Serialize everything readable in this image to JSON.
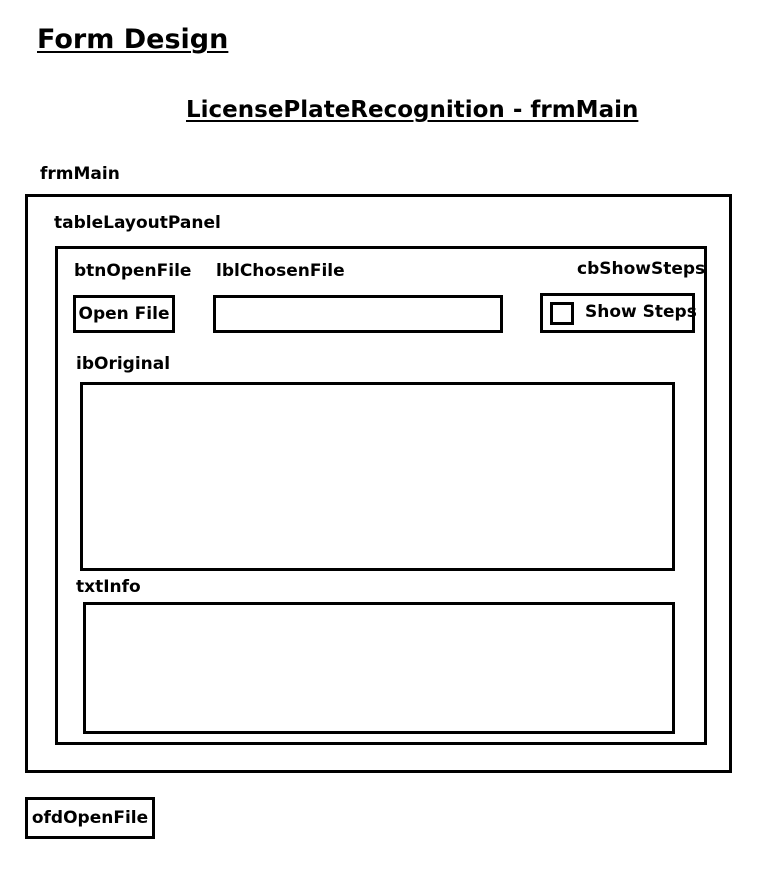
{
  "page": {
    "title": "Form Design",
    "subtitle": "LicensePlateRecognition - frmMain"
  },
  "form": {
    "name": "frmMain",
    "table_layout_panel": {
      "name": "tableLayoutPanel",
      "btn_open_file": {
        "name": "btnOpenFile",
        "text": "Open File"
      },
      "lbl_chosen_file": {
        "name": "lblChosenFile",
        "value": ""
      },
      "cb_show_steps": {
        "name": "cbShowSteps",
        "text": "Show Steps",
        "checked": false
      },
      "ib_original": {
        "name": "ibOriginal"
      },
      "txt_info": {
        "name": "txtInfo",
        "value": ""
      }
    }
  },
  "components": {
    "ofd_open_file": {
      "name": "ofdOpenFile"
    }
  },
  "colors": {
    "stroke": "#000000",
    "background": "#ffffff"
  }
}
